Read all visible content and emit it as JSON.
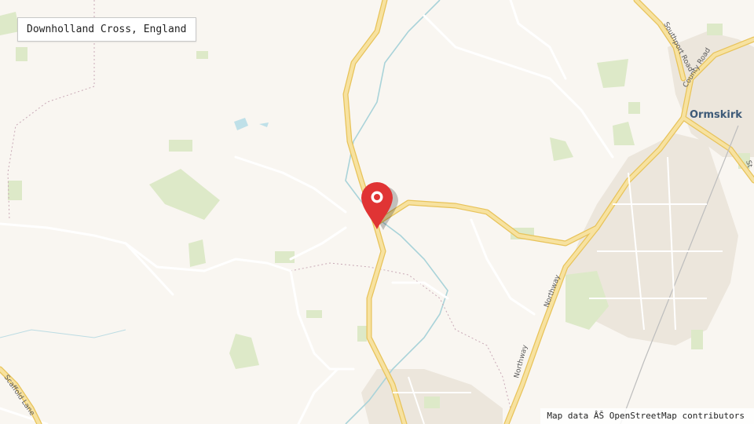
{
  "location_label": "Downholland Cross, England",
  "attribution": "Map data ÂŠ OpenStreetMap contributors",
  "places": {
    "ormskirk": "Ormskirk"
  },
  "roads": {
    "southport_road": "Southport Road",
    "county_road": "County Road",
    "northway_north": "Northway",
    "northway_south": "Northway",
    "scaffold_lane": "Scaffold Lane",
    "st_partial": "St"
  },
  "colors": {
    "background": "#f9f6f1",
    "major_road": "#f6dc84",
    "minor_road": "#ffffff",
    "water": "#bfe0e8",
    "river": "#a9d3d9",
    "green": "#dce9c9",
    "urban": "#ece7df",
    "marker": "#e03434"
  },
  "marker": {
    "icon": "map-pin-icon"
  }
}
